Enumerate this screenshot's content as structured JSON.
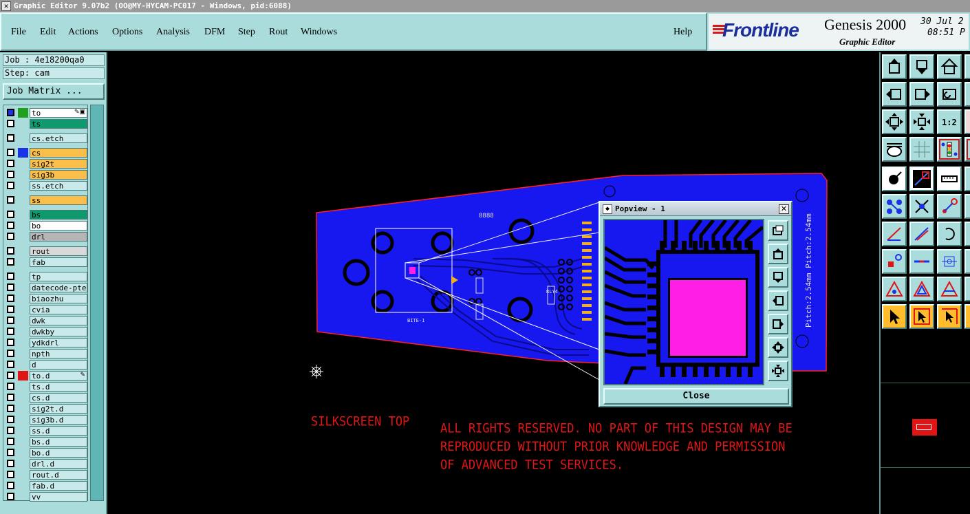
{
  "window": {
    "title": "Graphic Editor 9.07b2 (OO@MY-HYCAM-PC017 - Windows, pid:6088)"
  },
  "menu": {
    "items": [
      "File",
      "Edit",
      "Actions",
      "Options",
      "Analysis",
      "DFM",
      "Step",
      "Rout",
      "Windows"
    ],
    "help": "Help"
  },
  "brand": {
    "logo": "Frontline",
    "product": "Genesis 2000",
    "subtitle": "Graphic Editor",
    "date": "30 Jul 2",
    "time": "08:51 P"
  },
  "left_panel": {
    "job": "Job : 4e18200qa0",
    "step": "Step: cam",
    "job_matrix_label": "Job Matrix ..."
  },
  "layers": [
    {
      "name": "to",
      "bg": "#ffffff",
      "swatch": "#1fa01f",
      "active": true
    },
    {
      "name": "ts",
      "bg": "#0f9a6e"
    },
    {
      "name": "cs.etch",
      "bg": "#c8eaea"
    },
    {
      "name": "cs",
      "bg": "#f9bf4a",
      "swatch": "#1933e6"
    },
    {
      "name": "sig2t",
      "bg": "#f9bf4a"
    },
    {
      "name": "sig3b",
      "bg": "#f9bf4a"
    },
    {
      "name": "ss.etch",
      "bg": "#c8eaea"
    },
    {
      "name": "ss",
      "bg": "#f9bf4a"
    },
    {
      "name": "bs",
      "bg": "#0f9a6e"
    },
    {
      "name": "bo",
      "bg": "#ffffff"
    },
    {
      "name": "drl",
      "bg": "#b5b5b5"
    },
    {
      "name": "rout",
      "bg": "#d9d9d9"
    },
    {
      "name": "fab",
      "bg": "#c8eaea"
    },
    {
      "name": "tp",
      "bg": "#c8eaea"
    },
    {
      "name": "datecode-pte",
      "bg": "#c8eaea"
    },
    {
      "name": "biaozhu",
      "bg": "#c8eaea"
    },
    {
      "name": "cvia",
      "bg": "#c8eaea"
    },
    {
      "name": "dwk",
      "bg": "#c8eaea"
    },
    {
      "name": "dwkby",
      "bg": "#c8eaea"
    },
    {
      "name": "ydkdrl",
      "bg": "#c8eaea"
    },
    {
      "name": "npth",
      "bg": "#c8eaea"
    },
    {
      "name": "d",
      "bg": "#c8eaea"
    },
    {
      "name": "to.d",
      "bg": "#c8eaea",
      "swatch": "#e01616",
      "edit": true
    },
    {
      "name": "ts.d",
      "bg": "#c8eaea"
    },
    {
      "name": "cs.d",
      "bg": "#c8eaea"
    },
    {
      "name": "sig2t.d",
      "bg": "#c8eaea"
    },
    {
      "name": "sig3b.d",
      "bg": "#c8eaea"
    },
    {
      "name": "ss.d",
      "bg": "#c8eaea"
    },
    {
      "name": "bs.d",
      "bg": "#c8eaea"
    },
    {
      "name": "bo.d",
      "bg": "#c8eaea"
    },
    {
      "name": "drl.d",
      "bg": "#c8eaea"
    },
    {
      "name": "rout.d",
      "bg": "#c8eaea"
    },
    {
      "name": "fab.d",
      "bg": "#c8eaea"
    },
    {
      "name": "vv",
      "bg": "#c8eaea"
    }
  ],
  "canvas": {
    "silk_title": "SILKSCREEN TOP",
    "rights_line1": "ALL RIGHTS RESERVED. NO PART OF THIS DESIGN MAY BE",
    "rights_line2": "REPRODUCED WITHOUT PRIOR KNOWLEDGE AND PERMISSION",
    "rights_line3": "OF ADVANCED TEST SERVICES.",
    "pitch_label": "Pitch:2.54mm Pitch:2.54mm",
    "board_code": "8888",
    "comp_label_1": "BITE-1",
    "comp_label_2": "RLY4"
  },
  "popview": {
    "title": "Popview - 1",
    "close_label": "Close"
  },
  "colors": {
    "panel": "#a9dcdb",
    "board": "#1717f0",
    "pad": "#ff1ee6",
    "silk": "#e01616",
    "outline": "#ff2020"
  }
}
